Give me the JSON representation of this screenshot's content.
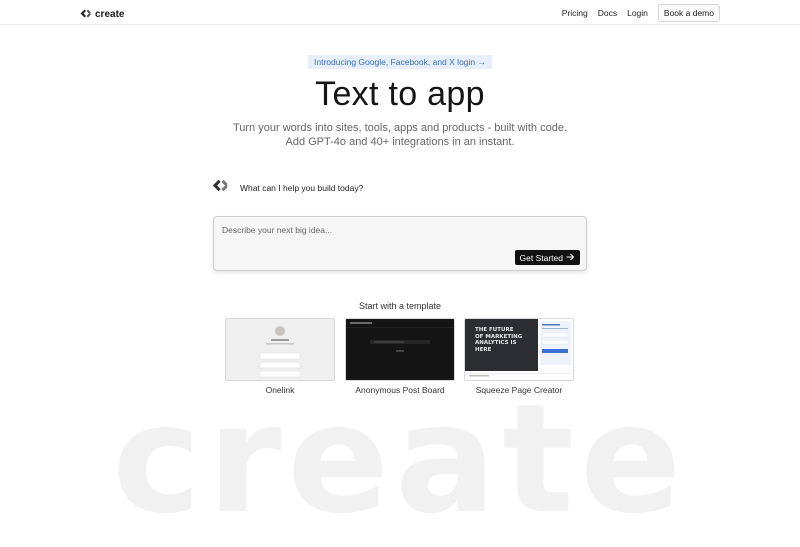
{
  "brand": {
    "name": "create",
    "watermark": "create"
  },
  "nav": {
    "pricing": "Pricing",
    "docs": "Docs",
    "login": "Login",
    "book_demo": "Book a demo"
  },
  "announcement": "Introducing Google, Facebook, and X login →",
  "hero": {
    "title": "Text to app",
    "subtitle_line1": "Turn your words into sites, tools, apps and products - built with code.",
    "subtitle_line2": "Add GPT-4o and 40+ integrations in an instant."
  },
  "assistant": {
    "question": "What can I help you build today?"
  },
  "prompt": {
    "placeholder": "Describe your next big idea...",
    "value": "",
    "submit_label": "Get Started"
  },
  "templates": {
    "heading": "Start with a template",
    "items": [
      {
        "label": "Onelink",
        "thumbnail": "profile-links-page"
      },
      {
        "label": "Anonymous Post Board",
        "thumbnail": "dark-post-board"
      },
      {
        "label": "Squeeze Page Creator",
        "thumbnail": "marketing-landing-page",
        "thumbnail_text": "THE FUTURE OF MARKETING ANALYTICS IS HERE"
      }
    ]
  },
  "colors": {
    "accent_bg": "#e6effb",
    "accent_text": "#3a6fb5",
    "button_dark": "#111111"
  },
  "icons": [
    "create-logo-icon",
    "arrow-right-icon"
  ]
}
